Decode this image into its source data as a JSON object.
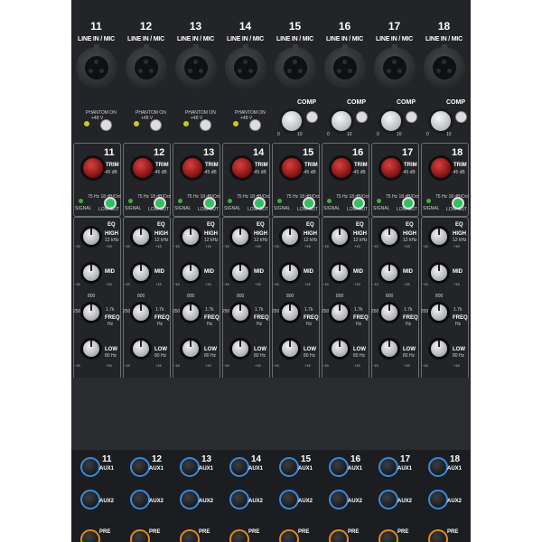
{
  "mixer": {
    "channels": [
      {
        "number": "11"
      },
      {
        "number": "12"
      },
      {
        "number": "13"
      },
      {
        "number": "14"
      },
      {
        "number": "15"
      },
      {
        "number": "16"
      },
      {
        "number": "17"
      },
      {
        "number": "18"
      }
    ],
    "labels": {
      "input": "LINE IN / MIC",
      "phantom": "PHANTOM ON",
      "phantom_v": "+48 V",
      "comp": "COMP",
      "trim": "TRIM",
      "trim_range": "-45 dB",
      "signal": "SIGNAL",
      "lowcut": "LOW CUT",
      "lowcut_spec": "75 Hz 18 dB/Oct",
      "eq": "EQ",
      "high": "HIGH",
      "high_freq": "12 kHz",
      "mid": "MID",
      "freq": "FREQ",
      "freq_unit": "Hz",
      "freq_top": "800",
      "freq_left": "250",
      "freq_right": "1.7k",
      "low": "LOW",
      "low_freq": "80 Hz",
      "minus15": "−15",
      "plus15": "+15",
      "zero": "0",
      "ten": "10",
      "aux1": "AUX1",
      "aux2": "AUX2",
      "pre": "PRE"
    },
    "colors": {
      "panel": "#222427",
      "trim_knob": "#b02020",
      "aux_ring": "#3a8ad8",
      "pan_ring": "#e08a18",
      "lowcut_button": "#30c060"
    }
  }
}
